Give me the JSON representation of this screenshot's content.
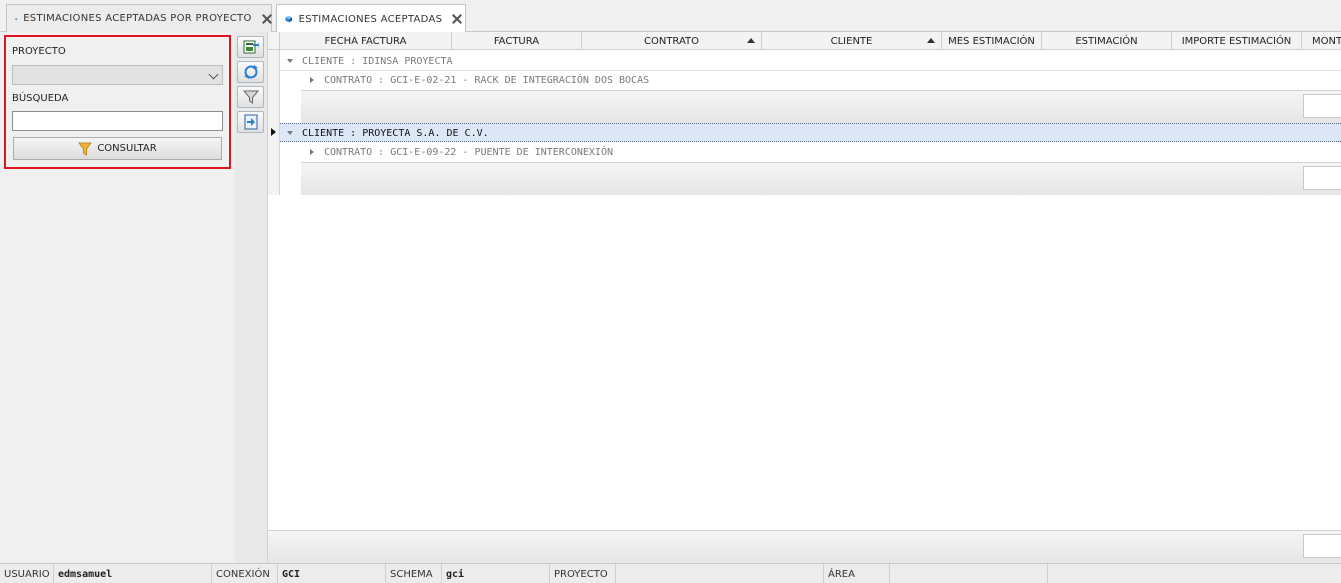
{
  "tabs": [
    {
      "label": "ESTIMACIONES ACEPTADAS POR PROYECTO",
      "active": false
    },
    {
      "label": "ESTIMACIONES ACEPTADAS",
      "active": true
    }
  ],
  "filters": {
    "proyecto_label": "PROYECTO",
    "proyecto_value": "",
    "busqueda_label": "BÚSQUEDA",
    "busqueda_value": "",
    "consultar_label": "CONSULTAR"
  },
  "toolbar": {
    "icons": [
      "export-excel-icon",
      "refresh-icon",
      "filter-icon",
      "exit-icon"
    ]
  },
  "grid": {
    "columns": [
      "FECHA FACTURA",
      "FACTURA",
      "CONTRATO",
      "CLIENTE",
      "MES ESTIMACIÓN",
      "ESTIMACIÓN",
      "IMPORTE ESTIMACIÓN",
      "MONTO"
    ],
    "sorted_columns": [
      "CONTRATO",
      "CLIENTE"
    ],
    "groups": [
      {
        "client": "CLIENTE : IDINSA PROYECTA",
        "contract": "CONTRATO : GCI-E-02-21 - RACK DE INTEGRACIÓN DOS BOCAS",
        "selected": false
      },
      {
        "client": "CLIENTE : PROYECTA S.A. DE C.V.",
        "contract": "CONTRATO : GCI-E-09-22 - PUENTE DE INTERCONEXIÓN",
        "selected": true
      }
    ]
  },
  "status": {
    "usuario_label": "USUARIO",
    "usuario_value": "edmsamuel",
    "conexion_label": "CONEXIÓN",
    "conexion_value": "GCI",
    "schema_label": "SCHEMA",
    "schema_value": "gci",
    "proyecto_label": "PROYECTO",
    "proyecto_value": "",
    "area_label": "ÁREA",
    "area_value": ""
  },
  "colors": {
    "highlight_border": "#e0141e",
    "selected_row": "#dde7f7"
  }
}
